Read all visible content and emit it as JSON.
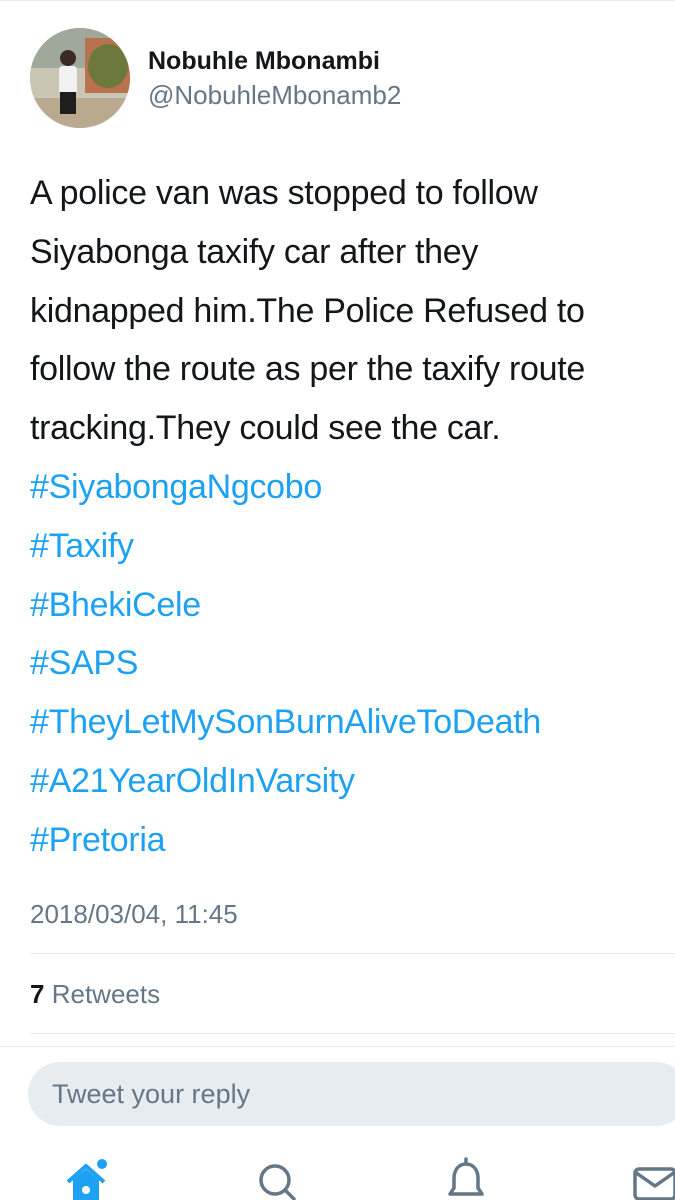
{
  "tweet": {
    "display_name": "Nobuhle Mbonambi",
    "handle": "@NobuhleMbonamb2",
    "text_lines": [
      "A police van was stopped to follow",
      "Siyabonga taxify car after they",
      "kidnapped him.The Police Refused to",
      "follow the route as per the taxify route",
      "tracking.They could see the car."
    ],
    "hashtags": [
      "#SiyabongaNgcobo",
      "#Taxify",
      "#BhekiCele",
      "#SAPS",
      "#TheyLetMySonBurnAliveToDeath",
      "#A21YearOldInVarsity",
      "#Pretoria"
    ],
    "timestamp": "2018/03/04, 11:45",
    "retweets": {
      "count": "7",
      "label": "Retweets"
    }
  },
  "reply": {
    "placeholder": "Tweet your reply"
  },
  "tabbar": {
    "icons": [
      "home-icon",
      "search-icon",
      "bell-icon",
      "mail-icon"
    ]
  },
  "colors": {
    "link": "#1da1f2",
    "secondary": "#657786",
    "reply_bg": "#e6ecf0"
  }
}
